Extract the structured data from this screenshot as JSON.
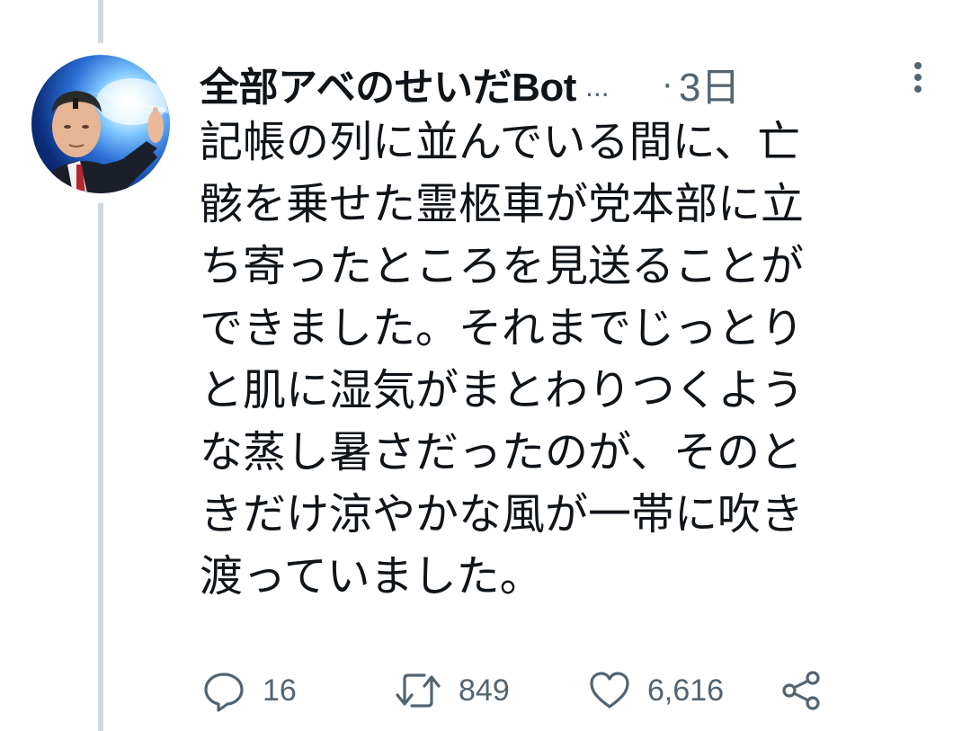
{
  "tweet": {
    "display_name": "全部アベのせいだBot",
    "name_truncation": "...",
    "separator": "·",
    "timestamp": "3日",
    "text_lines": [
      "記帳の列に並んでいる間に、亡",
      "骸を乗せた霊柩車が党本部に立",
      "ち寄ったところを見送ることが",
      "できました。それまでじっとり",
      "と肌に湿気がまとわりつくよう",
      "な蒸し暑さだったのが、そのと",
      "きだけ涼やかな風が一帯に吹き",
      "渡っていました。"
    ]
  },
  "actions": {
    "reply": {
      "icon": "reply-icon",
      "count": "16"
    },
    "retweet": {
      "icon": "retweet-icon",
      "count": "849"
    },
    "like": {
      "icon": "heart-icon",
      "count": "6,616"
    },
    "share": {
      "icon": "share-icon"
    }
  },
  "icons": {
    "more": "more-vertical-icon",
    "avatar": "avatar"
  },
  "colors": {
    "text": "#0f1419",
    "secondary": "#536471",
    "thread_line": "#cfd9de"
  }
}
